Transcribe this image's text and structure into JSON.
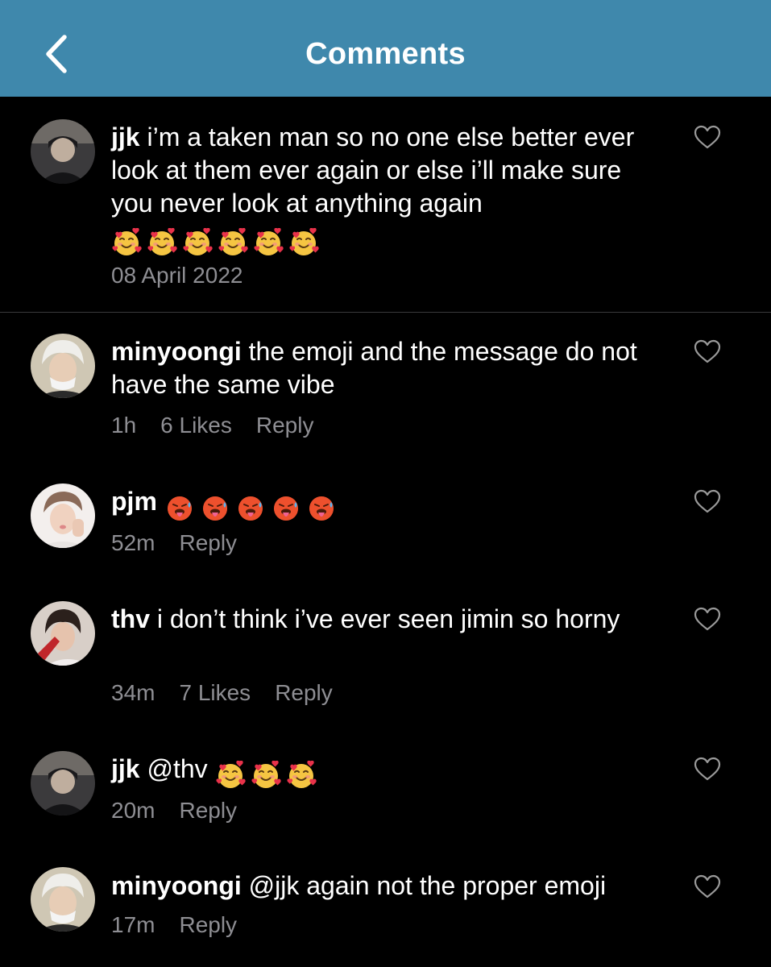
{
  "header": {
    "title": "Comments",
    "back_icon": "chevron-left-icon",
    "background": "#3f88ac"
  },
  "caption": {
    "username": "jjk",
    "text": "i’m a taken man so no one else better ever look at them ever again or else i’ll make sure you never look at anything again",
    "emojis": [
      "smiling-face-with-hearts",
      "smiling-face-with-hearts",
      "smiling-face-with-hearts",
      "smiling-face-with-hearts",
      "smiling-face-with-hearts",
      "smiling-face-with-hearts"
    ],
    "date": "08 April 2022"
  },
  "comments": [
    {
      "username": "minyoongi",
      "text": "the emoji and the message do not have the same vibe",
      "time": "1h",
      "likes": "6 Likes",
      "reply": "Reply"
    },
    {
      "username": "pjm",
      "text": "",
      "emojis": [
        "hot-face",
        "hot-face",
        "hot-face",
        "hot-face",
        "hot-face"
      ],
      "time": "52m",
      "reply": "Reply"
    },
    {
      "username": "thv",
      "text": "i don’t think i’ve ever seen jimin so horny",
      "time": "34m",
      "likes": "7 Likes",
      "reply": "Reply"
    },
    {
      "username": "jjk",
      "text": "@thv",
      "emojis": [
        "smiling-face-with-hearts",
        "smiling-face-with-hearts",
        "smiling-face-with-hearts"
      ],
      "time": "20m",
      "reply": "Reply"
    },
    {
      "username": "minyoongi",
      "text": "@jjk again not the proper emoji",
      "time": "17m",
      "reply": "Reply"
    }
  ],
  "colors": {
    "background": "#000000",
    "text": "#ffffff",
    "meta": "#8e8e93",
    "divider": "#3a3a3c"
  }
}
